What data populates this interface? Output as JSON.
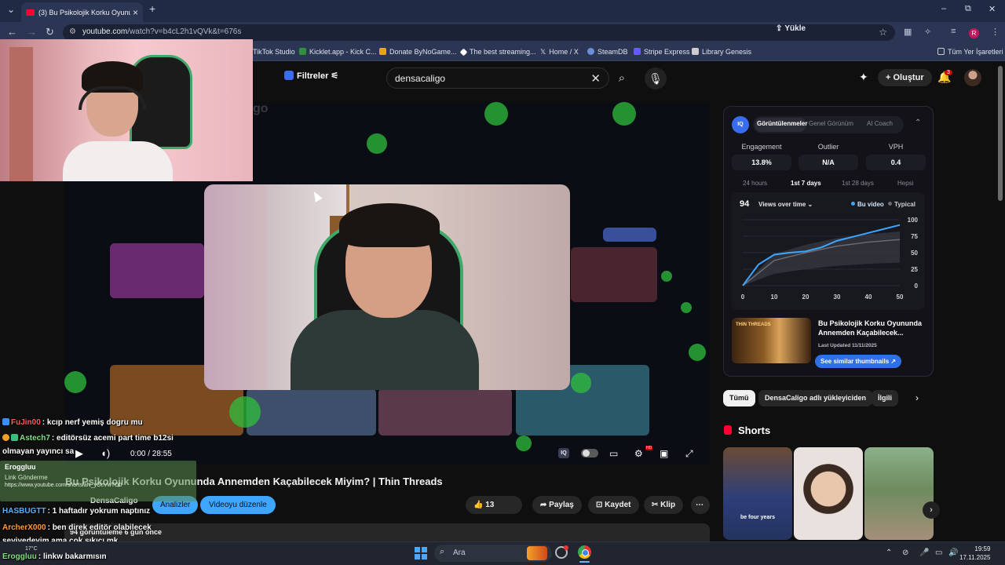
{
  "browser": {
    "tab_title": "(3) Bu Psikolojik Korku Oyununda",
    "tab_close": "×",
    "new_tab": "+",
    "url_host": "youtube.com",
    "url_path": "/watch?v=b4cL2h1vQVk&t=676s",
    "upload_label": "Yükle",
    "profile_initial": "R",
    "window": {
      "minimize": "–",
      "restore": "⧉",
      "close": "✕"
    }
  },
  "bookmarks": {
    "items": [
      {
        "label": "TikTok Studio",
        "color": "#111111"
      },
      {
        "label": "Kicklet.app - Kick C...",
        "color": "#2f8f3b"
      },
      {
        "label": "Donate ByNoGame...",
        "color": "#e8a317"
      },
      {
        "label": "The best streaming...",
        "color": "#ffffff"
      },
      {
        "label": "Home / X",
        "color": "#000000"
      },
      {
        "label": "SteamDB",
        "color": "#6b8fd6"
      },
      {
        "label": "Stripe Express",
        "color": "#635bff"
      },
      {
        "label": "Library Genesis",
        "color": "#cccccc"
      }
    ],
    "all_bookmarks": "Tüm Yer İşaretleri"
  },
  "youtube": {
    "filters_label": "Filtreler",
    "search_query": "densacaligo",
    "create_label": "Oluştur",
    "notif_count": "3"
  },
  "player": {
    "time": "0:00 / 28:55",
    "iq_label": "IQ"
  },
  "video": {
    "title": "Bu Psikolojik Korku Oyununda Annemden Kaçabilecek Miyim? | Thin Threads",
    "channel": "DensaCaligo",
    "analyze_label": "Analizler",
    "edit_label": "Videoyu düzenle",
    "likes": "13",
    "share_label": "Paylaş",
    "save_label": "Kaydet",
    "clip_label": "Klip",
    "meta": "94 görüntüleme  6 gün önce"
  },
  "chat": {
    "messages": [
      {
        "user": "FuJin00",
        "text": ": kcıp nerf yemiş dogru mu",
        "color": "#ff5a5a"
      },
      {
        "user": "Astech7",
        "text": ": editörsüz acemi part time b12si",
        "color": "#7fe37f"
      },
      {
        "user": "",
        "text": "olmayan yayıncı sa",
        "color": "#ffffff"
      },
      {
        "user": "HASBUGTT",
        "text": ": 1 haftadır yokrum naptınız",
        "color": "#5ab0ff"
      },
      {
        "user": "ArcherX000",
        "text": ": ben direk editör olabilecek",
        "color": "#ff9a3c"
      },
      {
        "user": "",
        "text": "seviyedeyim ama çok sıkıcı mk",
        "color": "#ffffff"
      },
      {
        "user": "Eroggluu",
        "text": ": linkw bakarmısın",
        "color": "#7fe37f"
      }
    ],
    "last_card": {
      "user": "Eroggluu",
      "line1": "Link Gönderme",
      "line2": "https://www.youtube.com/shorts/aN_yOcVwTO0"
    }
  },
  "iq_panel": {
    "logo": "IQ",
    "tabs": [
      "Görüntülenmeler",
      "Genel Görünüm",
      "AI Coach"
    ],
    "metrics": [
      {
        "label": "Engagement",
        "value": "13.8%"
      },
      {
        "label": "Outlier",
        "value": "N/A"
      },
      {
        "label": "VPH",
        "value": "0.4"
      }
    ],
    "ranges": [
      "24 hours",
      "1st 7 days",
      "1st 28 days",
      "Hepsi"
    ],
    "views": "94",
    "views_dropdown": "Views over time",
    "legend_this": "Bu video",
    "legend_typical": "Typical",
    "similar": {
      "thumb_text": "THIN THREADS",
      "title": "Bu Psikolojik Korku Oyununda Annemden Kaçabilecek...",
      "updated": "Last Updated 11/11/2025",
      "button": "See similar thumbnails ↗"
    },
    "colors": {
      "accent": "#3ea6ff",
      "typical": "#6b6b75"
    }
  },
  "chart_data": {
    "type": "line",
    "title": "",
    "xlabel": "",
    "ylabel": "",
    "x_ticks": [
      0,
      10,
      20,
      30,
      40,
      50
    ],
    "y_ticks": [
      0,
      25,
      50,
      75,
      100
    ],
    "xlim": [
      0,
      50
    ],
    "ylim": [
      0,
      100
    ],
    "series": [
      {
        "name": "Bu video",
        "x": [
          0,
          5,
          10,
          15,
          20,
          25,
          30,
          35,
          40,
          45,
          50
        ],
        "y": [
          0,
          32,
          47,
          50,
          52,
          58,
          68,
          74,
          80,
          86,
          92
        ]
      },
      {
        "name": "Typical",
        "x": [
          0,
          10,
          20,
          30,
          40,
          50
        ],
        "y": [
          0,
          38,
          50,
          60,
          66,
          70
        ],
        "band_low": [
          0,
          18,
          25,
          30,
          33,
          35
        ],
        "band_high": [
          0,
          48,
          62,
          72,
          78,
          82
        ]
      }
    ]
  },
  "chips": [
    "Tümü",
    "DensaCaligo adlı yükleyiciden",
    "İlgili"
  ],
  "shorts": {
    "heading": "Shorts",
    "s1_caption": "be four years"
  },
  "taskbar": {
    "search_label": "Ara",
    "time": "19:59",
    "date": "17.11.2025",
    "weather": "17°C"
  }
}
